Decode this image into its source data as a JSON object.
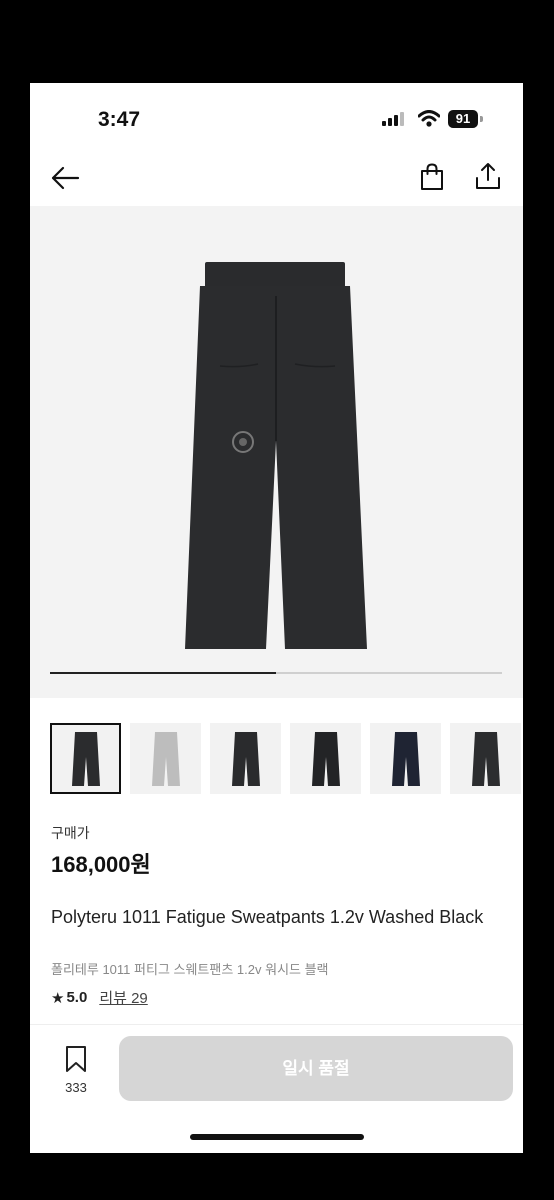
{
  "status_bar": {
    "time": "3:47",
    "battery": "91",
    "icons": [
      "signal-icon",
      "wifi-icon",
      "battery-icon"
    ]
  },
  "nav": {
    "icons": [
      "back-arrow-icon",
      "shopping-bag-icon",
      "share-icon"
    ]
  },
  "gallery": {
    "progress_fraction": 0.5,
    "thumbnail_colors": [
      "#2b2c2e",
      "#bdbdbd",
      "#2a2b2d",
      "#232426",
      "#1f2433",
      "#2c2d2f"
    ],
    "selected_index": 0
  },
  "product": {
    "price_label": "구매가",
    "price": "168,000원",
    "name_en": "Polyteru 1011 Fatigue Sweatpants 1.2v Washed Black",
    "name_ko": "폴리테루 1011 퍼티그 스웨트팬츠 1.2v 워시드 블랙",
    "rating": "5.0",
    "review_text": "리뷰 29"
  },
  "bottom_bar": {
    "bookmark_count": "333",
    "soldout_label": "일시 품절"
  },
  "colors": {
    "accent": "#111111",
    "disabled_button": "#d6d6d6",
    "image_bg": "#f3f3f3"
  }
}
